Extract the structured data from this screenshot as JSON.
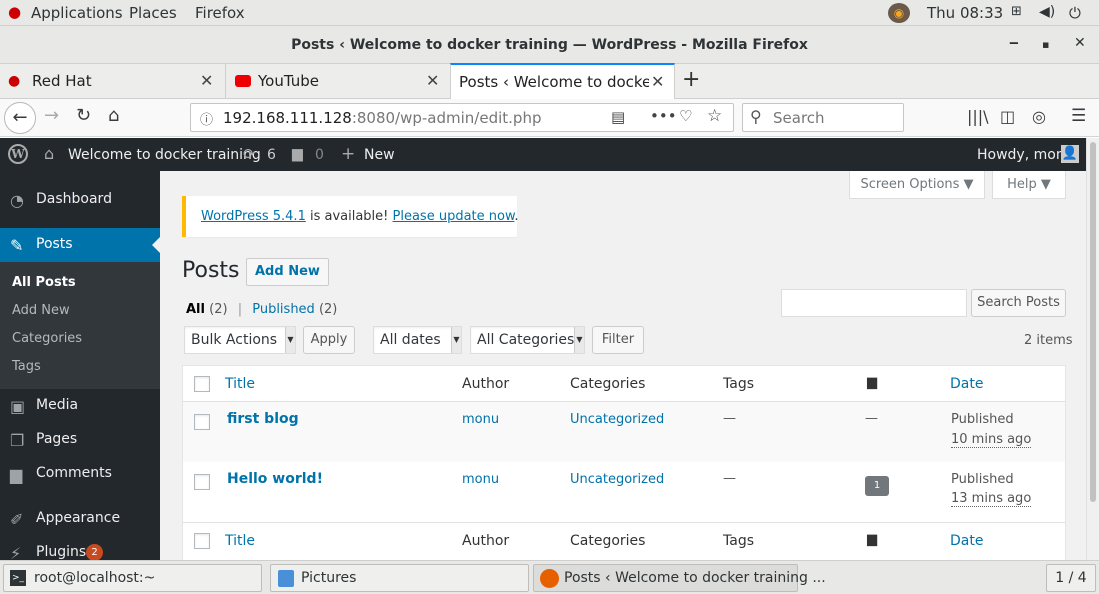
{
  "gnome": {
    "applications": "Applications",
    "places": "Places",
    "firefox": "Firefox",
    "clock": "Thu 08:33"
  },
  "window": {
    "title": "Posts ‹ Welcome to docker training — WordPress - Mozilla Firefox",
    "minimize": "‒",
    "maximize": "▪",
    "close": "✕"
  },
  "tabs": [
    {
      "label": "Red Hat"
    },
    {
      "label": "YouTube"
    },
    {
      "label": "Posts ‹ Welcome to docker tr"
    }
  ],
  "tab_close": "✕",
  "new_tab": "+",
  "url": {
    "host": "192.168.111.128",
    "rest": ":8080/wp-admin/edit.php"
  },
  "search": {
    "placeholder": "Search"
  },
  "adminbar": {
    "site_name": "Welcome to docker training",
    "updates_count": "6",
    "comments_count": "0",
    "new_label": "New",
    "howdy": "Howdy, monu"
  },
  "sidebar": {
    "dashboard": "Dashboard",
    "posts": "Posts",
    "submenu": [
      "All Posts",
      "Add New",
      "Categories",
      "Tags"
    ],
    "media": "Media",
    "pages": "Pages",
    "comments": "Comments",
    "appearance": "Appearance",
    "plugins": "Plugins",
    "plugins_badge": "2"
  },
  "screen_options": "Screen Options ▼",
  "help": "Help ▼",
  "notice": {
    "link1": "WordPress 5.4.1",
    "text": " is available! ",
    "link2": "Please update now",
    "end": "."
  },
  "page": {
    "title": "Posts",
    "add_new": "Add New"
  },
  "views": {
    "all": "All",
    "all_count": "(2)",
    "sep": "|",
    "published": "Published",
    "published_count": "(2)"
  },
  "search_posts": "Search Posts",
  "filters": {
    "bulk": "Bulk Actions",
    "apply": "Apply",
    "dates": "All dates",
    "categories": "All Categories",
    "filter": "Filter",
    "items": "2 items"
  },
  "table": {
    "headers": {
      "title": "Title",
      "author": "Author",
      "categories": "Categories",
      "tags": "Tags",
      "date": "Date"
    },
    "rows": [
      {
        "title": "first blog",
        "author": "monu",
        "category": "Uncategorized",
        "tags": "—",
        "comments": "—",
        "status": "Published",
        "date": "10 mins ago"
      },
      {
        "title": "Hello world!",
        "author": "monu",
        "category": "Uncategorized",
        "tags": "—",
        "comments": "1",
        "status": "Published",
        "date": "13 mins ago"
      }
    ]
  },
  "taskbar": {
    "terminal": "root@localhost:~",
    "pictures": "Pictures",
    "firefox": "Posts ‹ Welcome to docker training ...",
    "workspace": "1 / 4"
  },
  "colors": {
    "wp_dark": "#23282d",
    "wp_blue": "#0073aa",
    "wp_active": "#0073aa",
    "notice_border": "#ffb900"
  }
}
